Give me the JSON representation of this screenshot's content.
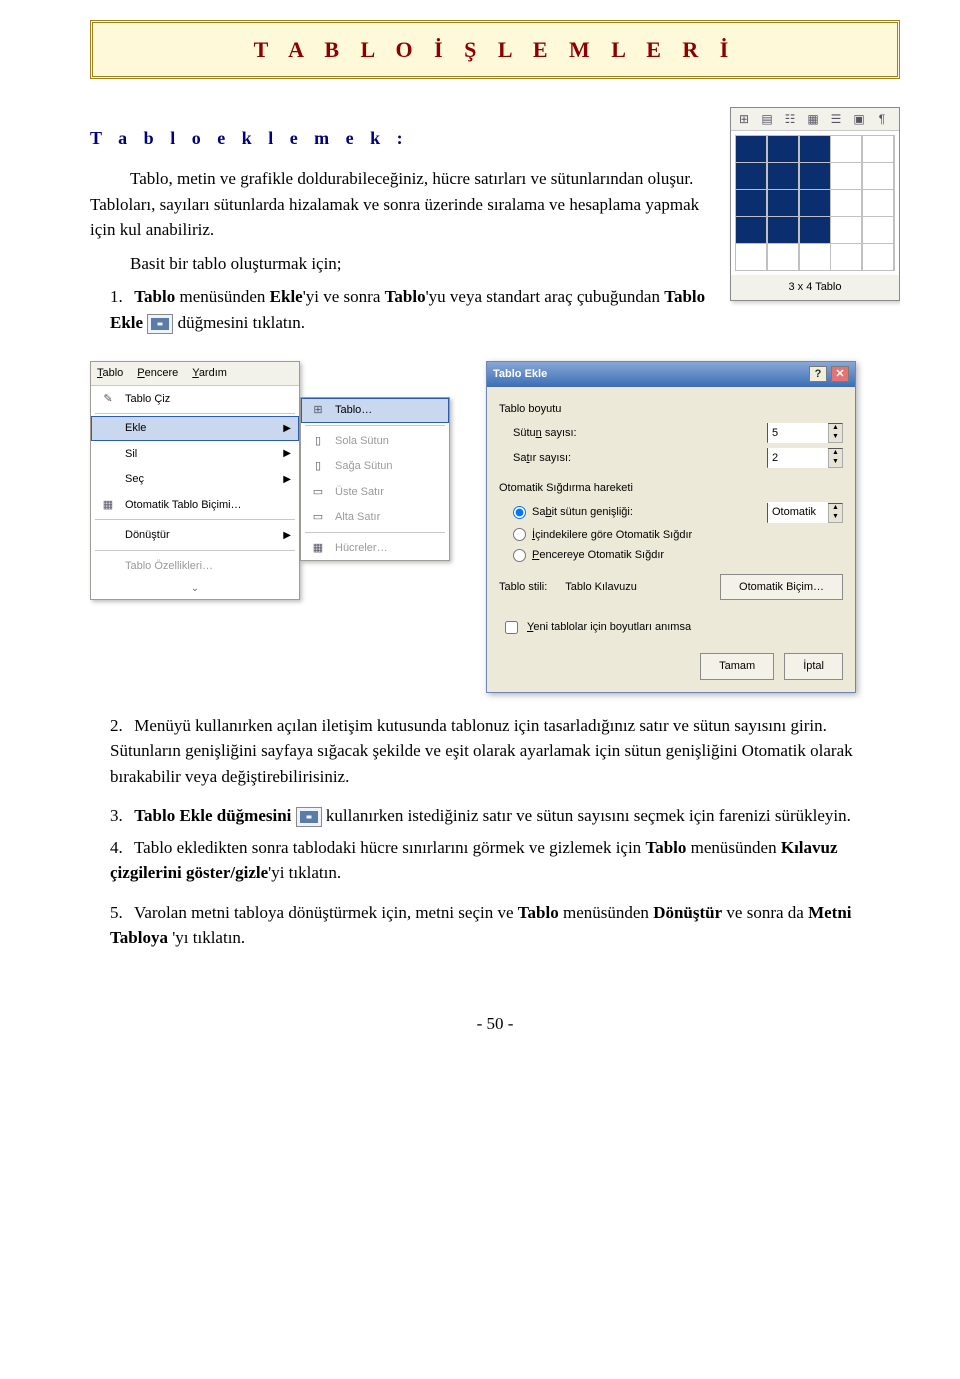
{
  "title_banner": "T A B L O   İ Ş L E M L E R İ",
  "section_heading": "T a b l o   e k l e m e k :",
  "intro1": "Tablo, metin ve grafikle doldurabileceğiniz, hücre satırları ve sütunlarından oluşur. Tabloları, sayıları sütunlarda hizalamak ve sonra üzerinde sıralama ve hesaplama yapmak için kul anabiliriz.",
  "intro2": "Basit bir tablo oluşturmak için;",
  "step1a": "Tablo menüsünden Ekle'yi ve sonra Tablo'yu veya standart araç çubuğundan Tablo Ekle",
  "step1b": "düğmesini tıklatın.",
  "picker": {
    "toolbar_icons": [
      "⊞",
      "▤",
      "☷",
      "▦",
      "☰",
      "▣",
      "¶"
    ],
    "selection_rows": 4,
    "selection_cols": 3,
    "grid_rows": 5,
    "grid_cols": 5,
    "footer": "3 x 4 Tablo"
  },
  "menu": {
    "bar": [
      "Tablo",
      "Pencere",
      "Yardım"
    ],
    "items": [
      {
        "icon": "✎",
        "label": "Tablo Çiz",
        "arrow": false
      },
      {
        "sep": true
      },
      {
        "icon": "",
        "label": "Ekle",
        "arrow": true,
        "hov": true
      },
      {
        "icon": "",
        "label": "Sil",
        "arrow": true
      },
      {
        "icon": "",
        "label": "Seç",
        "arrow": true
      },
      {
        "icon": "▦",
        "label": "Otomatik Tablo Biçimi…",
        "arrow": false
      },
      {
        "sep": true
      },
      {
        "icon": "",
        "label": "Dönüştür",
        "arrow": true
      },
      {
        "sep": true
      },
      {
        "icon": "",
        "label": "Tablo Özellikleri…",
        "arrow": false,
        "disabled": true
      }
    ],
    "submenu": [
      {
        "icon": "⊞",
        "label": "Tablo…",
        "hov": true
      },
      {
        "sep": true
      },
      {
        "icon": "▯",
        "label": "Sola Sütun",
        "disabled": true
      },
      {
        "icon": "▯",
        "label": "Sağa Sütun",
        "disabled": true
      },
      {
        "icon": "▭",
        "label": "Üste Satır",
        "disabled": true
      },
      {
        "icon": "▭",
        "label": "Alta Satır",
        "disabled": true
      },
      {
        "sep": true
      },
      {
        "icon": "▦",
        "label": "Hücreler…",
        "disabled": true
      }
    ]
  },
  "dialog": {
    "title": "Tablo Ekle",
    "grp1": "Tablo boyutu",
    "col_label": "Sütun sayısı:",
    "col_val": "5",
    "row_label": "Satır sayısı:",
    "row_val": "2",
    "grp2": "Otomatik Sığdırma hareketi",
    "r1": "Sabit sütun genişliği:",
    "r1_val": "Otomatik",
    "r2": "İçindekilere göre Otomatik Sığdır",
    "r3": "Pencereye Otomatik Sığdır",
    "style_label": "Tablo stili:",
    "style_val": "Tablo Kılavuzu",
    "style_btn": "Otomatik Biçim…",
    "remember": "Yeni tablolar için boyutları anımsa",
    "ok": "Tamam",
    "cancel": "İptal"
  },
  "step2": "Menüyü kullanırken açılan iletişim kutusunda tablonuz için tasarladığınız satır ve sütun sayısını girin. Sütunların genişliğini sayfaya sığacak                 şekilde ve eşit olarak ayarlamak için sütun genişliğini Otomatik olarak bırakabilir veya değiştirebilirisiniz.",
  "step3a": "Tablo Ekle düğmesini",
  "step3b": "kullanırken istediğiniz satır ve sütun sayısını seçmek için farenizi sürükleyin.",
  "step4": "Tablo ekledikten sonra tablodaki hücre sınırlarını görmek ve gizlemek için Tablo menüsünden Kılavuz çizgilerini göster/gizle'yi tıklatın.",
  "step5": "Varolan metni tabloya dönüştürmek için, metni seçin ve Tablo menüsünden Dönüştür ve sonra da Metni Tabloya  'yı tıklatın.",
  "page_num": "- 50 -"
}
